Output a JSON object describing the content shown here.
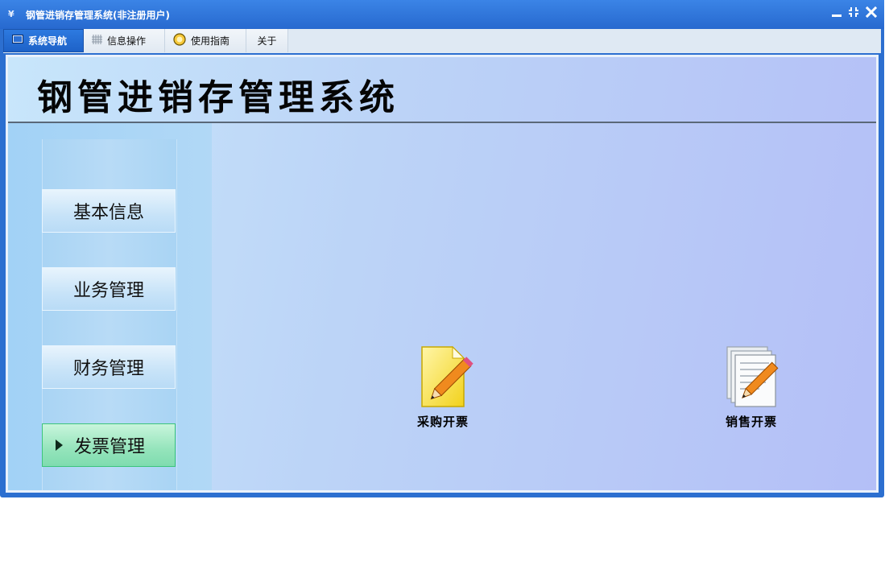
{
  "window": {
    "title": "钢管进销存管理系统(非注册用户)",
    "app_icon": "¥",
    "controls": {
      "minimize": "minimize-icon",
      "restore": "restore-icon",
      "close": "close-icon"
    }
  },
  "menu": {
    "tabs": [
      {
        "label": "系统导航",
        "icon": "monitor-icon",
        "active": true
      },
      {
        "label": "信息操作",
        "icon": "grid-icon",
        "active": false
      },
      {
        "label": "使用指南",
        "icon": "lightbulb-icon",
        "active": false
      },
      {
        "label": "关于",
        "icon": "",
        "active": false
      }
    ]
  },
  "header": {
    "title": "钢管进销存管理系统"
  },
  "sidebar": {
    "items": [
      {
        "label": "基本信息",
        "active": false
      },
      {
        "label": "业务管理",
        "active": false
      },
      {
        "label": "财务管理",
        "active": false
      },
      {
        "label": "发票管理",
        "active": true
      }
    ]
  },
  "main": {
    "features": [
      {
        "label": "采购开票",
        "icon": "note-pencil-icon"
      },
      {
        "label": "销售开票",
        "icon": "documents-pencil-icon"
      }
    ]
  },
  "colors": {
    "titlebar": "#2769cf",
    "active_tab": "#1e62c8",
    "active_sidebar": "#94e4bb",
    "content_gradient_start": "#c8e6fb",
    "content_gradient_end": "#b4bff7"
  }
}
